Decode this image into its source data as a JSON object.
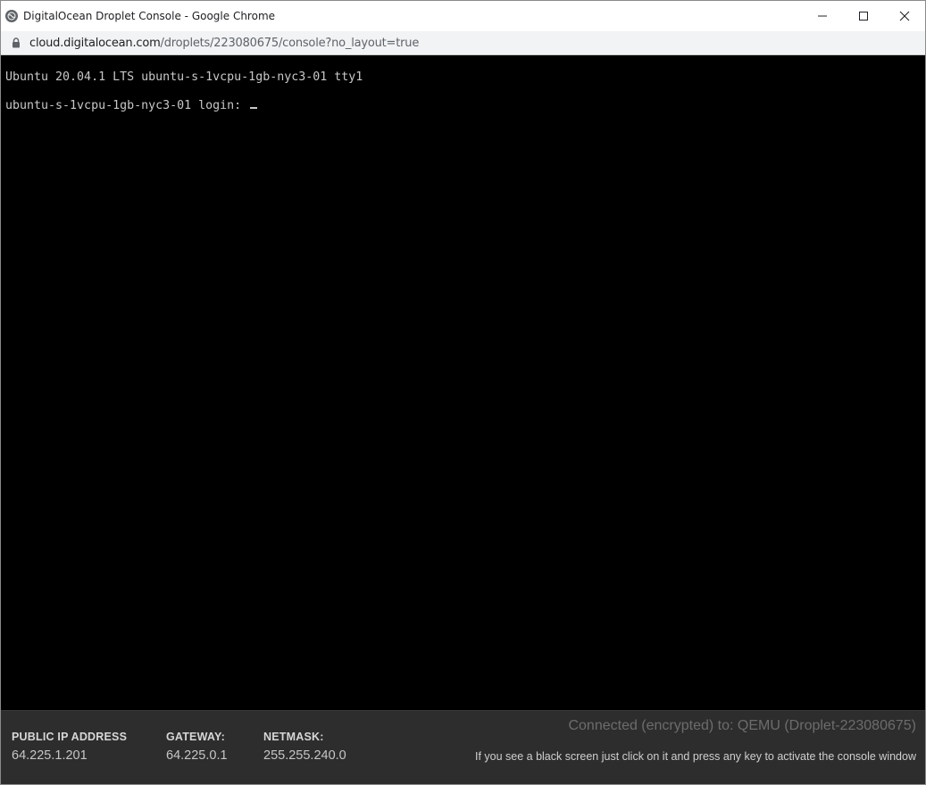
{
  "window": {
    "title": "DigitalOcean Droplet Console - Google Chrome",
    "controls": [
      "minimize-icon",
      "maximize-icon",
      "close-icon"
    ]
  },
  "address": {
    "host": "cloud.digitalocean.com",
    "path": "/droplets/223080675/console?no_layout=true"
  },
  "terminal": {
    "line1": "Ubuntu 20.04.1 LTS ubuntu-s-1vcpu-1gb-nyc3-01 tty1",
    "prompt": "ubuntu-s-1vcpu-1gb-nyc3-01 login: "
  },
  "footer": {
    "public_ip_label": "PUBLIC IP ADDRESS",
    "public_ip_value": "64.225.1.201",
    "gateway_label": "GATEWAY:",
    "gateway_value": "64.225.0.1",
    "netmask_label": "NETMASK:",
    "netmask_value": "255.255.240.0",
    "status": "Connected (encrypted) to: QEMU (Droplet-223080675)",
    "hint": "If you see a black screen just click on it and press any key to activate the console window"
  }
}
